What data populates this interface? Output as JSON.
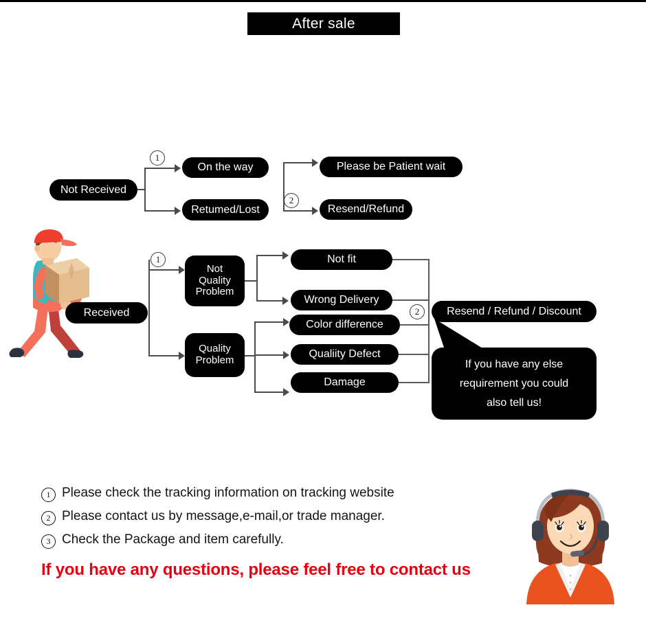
{
  "header": {
    "title": "After sale"
  },
  "flow_top": {
    "source": {
      "label": "Not Received"
    },
    "marker_1": "1",
    "marker_2": "2",
    "branches": [
      {
        "label": "On the way"
      },
      {
        "label": "Retumed/Lost"
      }
    ],
    "outcomes": [
      {
        "label": "Please be Patient wait"
      },
      {
        "label": "Resend/Refund"
      }
    ]
  },
  "flow_bottom": {
    "source": {
      "label": "Received"
    },
    "marker_1": "1",
    "marker_2": "2",
    "categories": [
      {
        "label": "Not\nQuality\nProblem"
      },
      {
        "label": "Quality\nProblem"
      }
    ],
    "issues": [
      {
        "label": "Not fit"
      },
      {
        "label": "Wrong Delivery"
      },
      {
        "label": "Color difference"
      },
      {
        "label": "Qualiity Defect"
      },
      {
        "label": "Damage"
      }
    ],
    "outcome": {
      "label": "Resend / Refund / Discount"
    },
    "bubble": {
      "text": "If you have any else\nrequirement you could\nalso tell us!"
    }
  },
  "notes": {
    "items": [
      {
        "mark": "1",
        "text": "Please check the tracking information on tracking website"
      },
      {
        "mark": "2",
        "text": "Please contact us by message,e-mail,or trade manager."
      },
      {
        "mark": "3",
        "text": "Check the Package and item carefully."
      }
    ],
    "highlight": "If you have any questions, please feel free to contact us"
  },
  "illustrations": {
    "delivery_man": "delivery-man-illustration",
    "support_agent": "customer-support-agent-illustration"
  },
  "colors": {
    "node_bg": "#000000",
    "node_text": "#ffffff",
    "connector": "#4a4a4a",
    "highlight_red": "#e60012",
    "page_bg": "#ffffff"
  }
}
